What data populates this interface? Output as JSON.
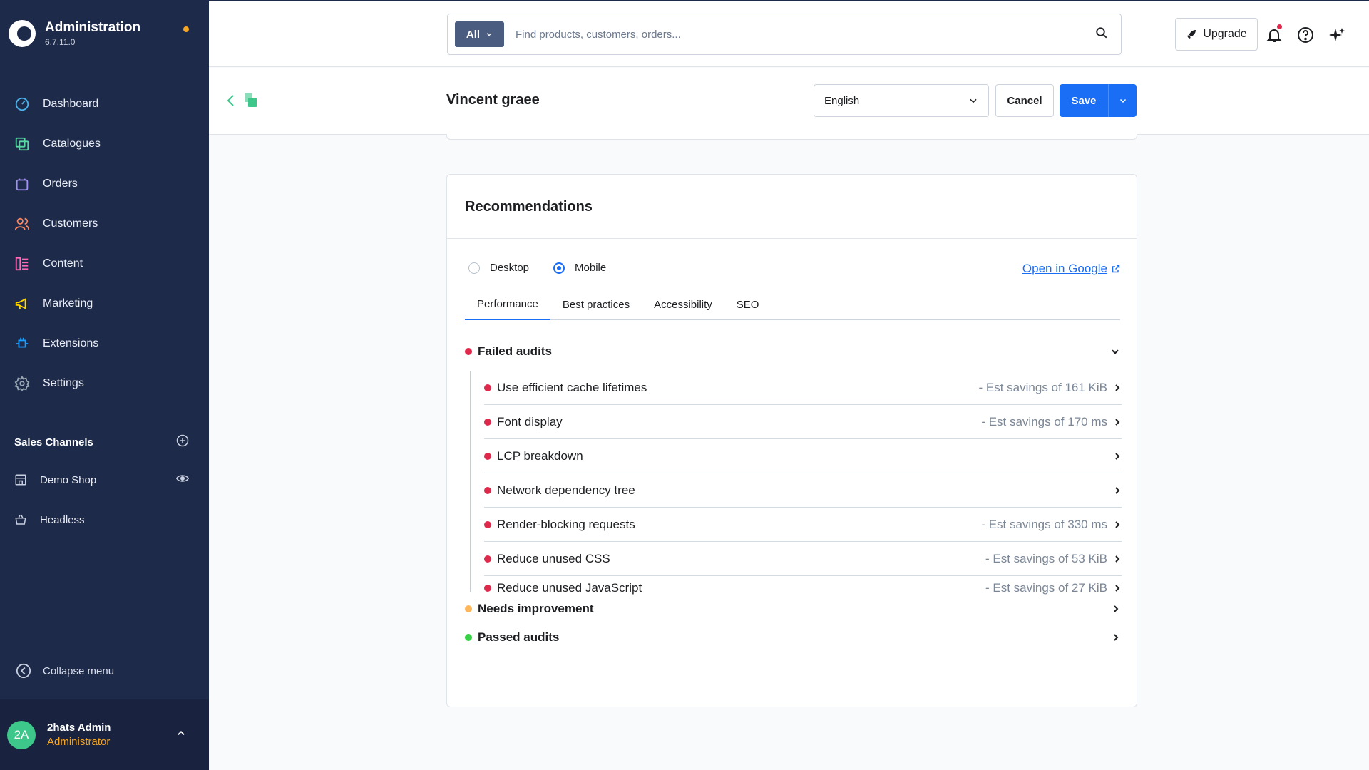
{
  "brand": {
    "title": "Administration",
    "version": "6.7.11.0"
  },
  "nav": [
    {
      "label": "Dashboard",
      "icon": "dashboard-icon",
      "color": "#4bb3ec"
    },
    {
      "label": "Catalogues",
      "icon": "catalogues-icon",
      "color": "#57d9a3"
    },
    {
      "label": "Orders",
      "icon": "orders-icon",
      "color": "#a092f0"
    },
    {
      "label": "Customers",
      "icon": "customers-icon",
      "color": "#f88962"
    },
    {
      "label": "Content",
      "icon": "content-icon",
      "color": "#ff68b4"
    },
    {
      "label": "Marketing",
      "icon": "marketing-icon",
      "color": "#ffd700"
    },
    {
      "label": "Extensions",
      "icon": "extensions-icon",
      "color": "#189eff"
    },
    {
      "label": "Settings",
      "icon": "settings-icon",
      "color": "#9aa8b5"
    }
  ],
  "sales_channels": {
    "title": "Sales Channels",
    "items": [
      {
        "label": "Demo Shop"
      },
      {
        "label": "Headless"
      }
    ]
  },
  "collapse_label": "Collapse menu",
  "user": {
    "initials": "2A",
    "name": "2hats Admin",
    "role": "Administrator"
  },
  "search": {
    "type": "All",
    "placeholder": "Find products, customers, orders..."
  },
  "header": {
    "upgrade_label": "Upgrade"
  },
  "page": {
    "title": "Vincent graee",
    "language": "English",
    "cancel_label": "Cancel",
    "save_label": "Save"
  },
  "recommendations": {
    "title": "Recommendations",
    "devices": [
      {
        "label": "Desktop",
        "checked": false
      },
      {
        "label": "Mobile",
        "checked": true
      }
    ],
    "google_link": "Open in Google",
    "tabs": [
      "Performance",
      "Best practices",
      "Accessibility",
      "SEO"
    ],
    "active_tab": "Performance",
    "failed_title": "Failed audits",
    "failed": [
      {
        "label": "Use efficient cache lifetimes",
        "savings": "- Est savings of 161 KiB"
      },
      {
        "label": "Font display",
        "savings": "- Est savings of 170 ms"
      },
      {
        "label": "LCP breakdown",
        "savings": ""
      },
      {
        "label": "Network dependency tree",
        "savings": ""
      },
      {
        "label": "Render-blocking requests",
        "savings": "- Est savings of 330 ms"
      },
      {
        "label": "Reduce unused CSS",
        "savings": "- Est savings of 53 KiB"
      },
      {
        "label": "Reduce unused JavaScript",
        "savings": "- Est savings of 27 KiB"
      }
    ],
    "needs_title": "Needs improvement",
    "passed_title": "Passed audits"
  },
  "colors": {
    "sidebar": "#1e2a4a",
    "accent": "#1a6ef5",
    "fail": "#de294c",
    "warn": "#ffb75d",
    "pass": "#37d046"
  }
}
